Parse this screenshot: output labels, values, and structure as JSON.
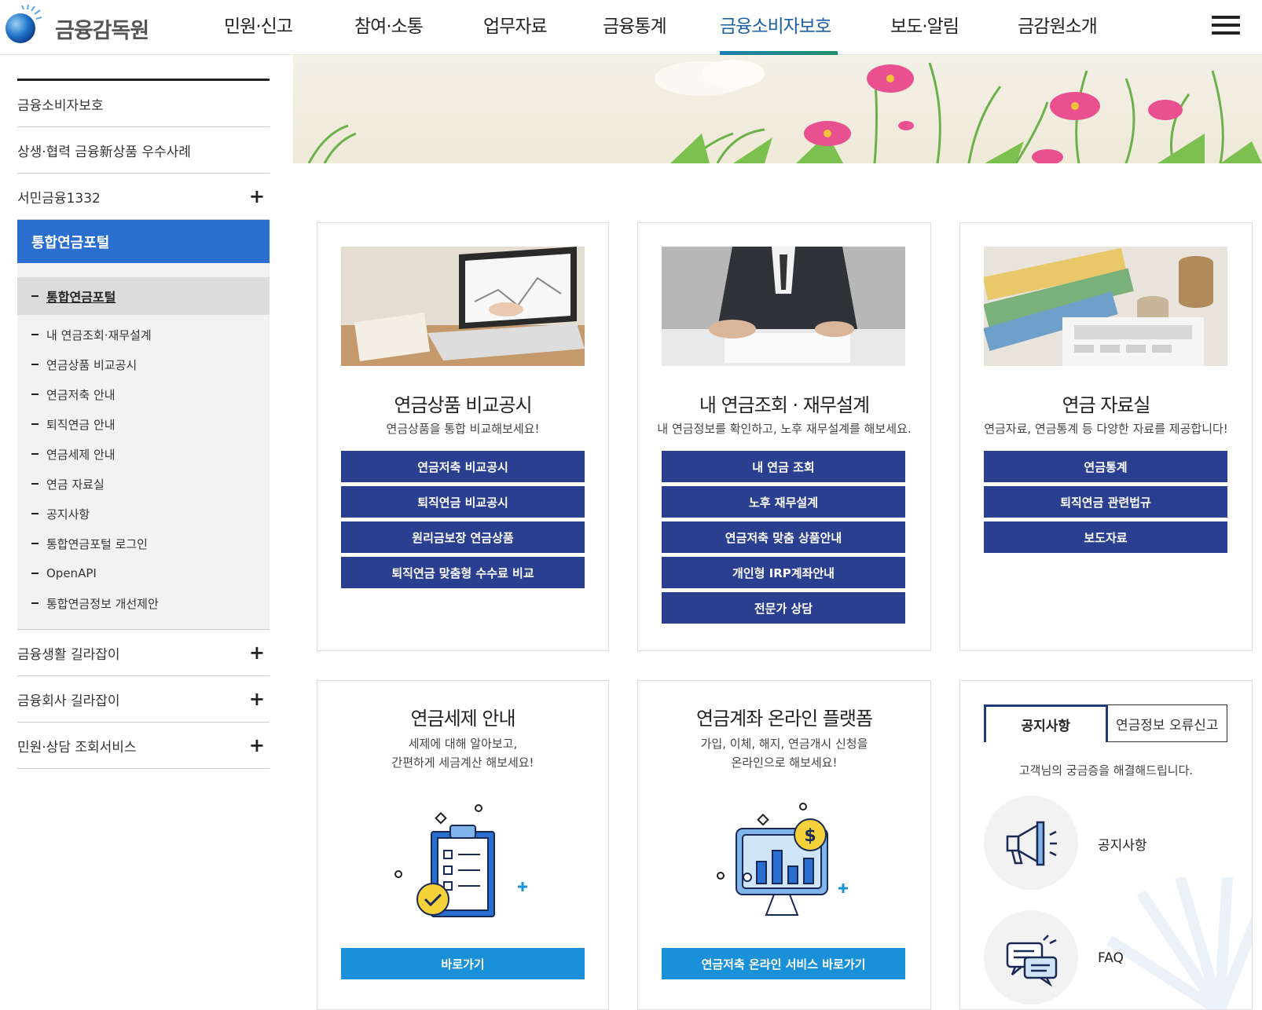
{
  "header": {
    "logo_text": "금융감독원",
    "nav": [
      "민원·신고",
      "참여·소통",
      "업무자료",
      "금융통계",
      "금융소비자보호",
      "보도·알림",
      "금감원소개"
    ],
    "active_nav": "금융소비자보호"
  },
  "sidebar": {
    "items_top": [
      {
        "label": "금융소비자보호",
        "expandable": false
      },
      {
        "label": "상생·협력 금융新상품 우수사례",
        "expandable": false
      },
      {
        "label": "서민금융1332",
        "expandable": true,
        "icon": "plus"
      }
    ],
    "active": "통합연금포털",
    "sub_current": "통합연금포털",
    "sub_items": [
      "내 연금조회·재무설계",
      "연금상품 비교공시",
      "연금저축 안내",
      "퇴직연금 안내",
      "연금세제 안내",
      "연금 자료실",
      "공지사항",
      "통합연금포털 로그인",
      "OpenAPI",
      "통합연금정보 개선제안"
    ],
    "items_bottom": [
      {
        "label": "금융생활 길라잡이",
        "icon": "plus"
      },
      {
        "label": "금융회사 길라잡이",
        "icon": "plus"
      },
      {
        "label": "민원·상담 조회서비스",
        "icon": "plus"
      }
    ]
  },
  "cards": {
    "compare": {
      "title": "연금상품 비교공시",
      "desc": "연금상품을 통합 비교해보세요!",
      "buttons": [
        "연금저축 비교공시",
        "퇴직연금 비교공시",
        "원리금보장 연금상품",
        "퇴직연금 맞춤형 수수료 비교"
      ]
    },
    "mypension": {
      "title": "내 연금조회 · 재무설계",
      "desc": "내 연금정보를 확인하고, 노후 재무설계를 해보세요.",
      "buttons": [
        "내 연금 조회",
        "노후 재무설계",
        "연금저축 맞춤 상품안내",
        "개인형 IRP계좌안내",
        "전문가 상담"
      ]
    },
    "library": {
      "title": "연금 자료실",
      "desc": "연금자료, 연금통계 등 다양한 자료를 제공합니다!",
      "buttons": [
        "연금통계",
        "퇴직연금 관련법규",
        "보도자료"
      ]
    },
    "tax": {
      "title": "연금세제 안내",
      "desc1": "세제에 대해 알아보고,",
      "desc2": "간편하게 세금계산 해보세요!",
      "button": "바로가기"
    },
    "platform": {
      "title": "연금계좌 온라인 플랫폼",
      "desc1": "가입, 이체, 해지, 연금개시 신청을",
      "desc2": "온라인으로 해보세요!",
      "button": "연금저축 온라인 서비스 바로가기"
    },
    "notice": {
      "tabs": [
        "공지사항",
        "연금정보 오류신고"
      ],
      "desc": "고객님의 궁금증을 해결해드립니다.",
      "links": [
        "공지사항",
        "FAQ"
      ]
    }
  },
  "colors": {
    "primary_button": "#2a3f8f",
    "cyan_button": "#1a90d8",
    "sidebar_active": "#2a6fcf",
    "nav_active": "#1b5fa5"
  }
}
